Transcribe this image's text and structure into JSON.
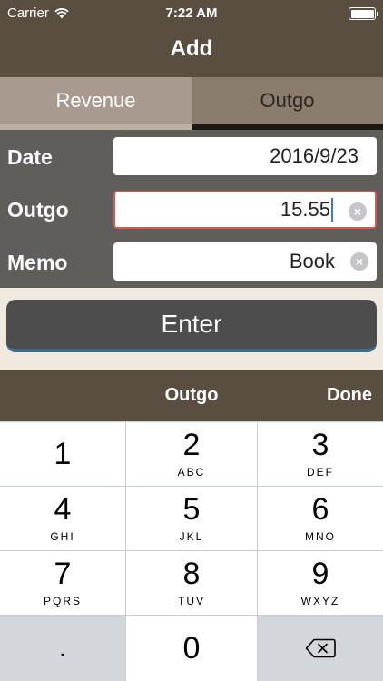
{
  "status_bar": {
    "carrier": "Carrier",
    "time": "7:22 AM"
  },
  "nav": {
    "title": "Add"
  },
  "tabs": [
    {
      "label": "Revenue"
    },
    {
      "label": "Outgo"
    }
  ],
  "form": {
    "date": {
      "label": "Date",
      "value": "2016/9/23"
    },
    "outgo": {
      "label": "Outgo",
      "value": "15.55"
    },
    "memo": {
      "label": "Memo",
      "value": "Book"
    }
  },
  "enter_label": "Enter",
  "accessory": {
    "title": "Outgo",
    "done_label": "Done"
  },
  "keypad": {
    "keys": [
      {
        "num": "1",
        "letters": ""
      },
      {
        "num": "2",
        "letters": "ABC"
      },
      {
        "num": "3",
        "letters": "DEF"
      },
      {
        "num": "4",
        "letters": "GHI"
      },
      {
        "num": "5",
        "letters": "JKL"
      },
      {
        "num": "6",
        "letters": "MNO"
      },
      {
        "num": "7",
        "letters": "PQRS"
      },
      {
        "num": "8",
        "letters": "TUV"
      },
      {
        "num": "9",
        "letters": "WXYZ"
      },
      {
        "num": ".",
        "letters": ""
      },
      {
        "num": "0",
        "letters": ""
      },
      {
        "num": "",
        "letters": "",
        "icon": "backspace-icon"
      }
    ]
  },
  "colors": {
    "nav_bg": "#5a4e40",
    "form_bg": "#5f5e5b",
    "active_border": "#d6594d",
    "caret": "#3a78f2"
  }
}
